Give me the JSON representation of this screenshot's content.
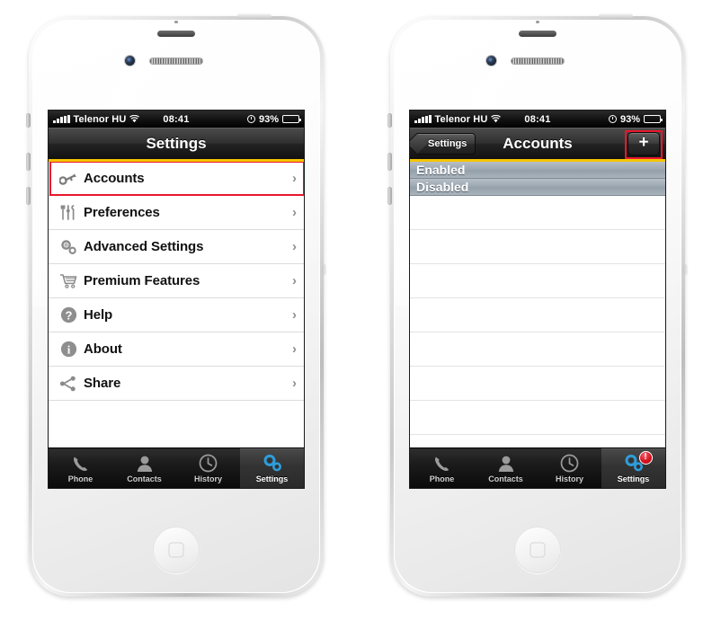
{
  "statusbar": {
    "carrier": "Telenor HU",
    "time": "08:41",
    "battery_percent": "93%",
    "signal_icon": "signal-bars-icon",
    "wifi_icon": "wifi-icon",
    "alarm_icon": "alarm-clock-icon",
    "battery_icon": "battery-icon"
  },
  "phone_left": {
    "navbar": {
      "title": "Settings"
    },
    "menu": [
      {
        "label": "Accounts",
        "icon": "key-icon",
        "chevron": "›",
        "highlighted": true
      },
      {
        "label": "Preferences",
        "icon": "tools-icon",
        "chevron": "›",
        "highlighted": false
      },
      {
        "label": "Advanced Settings",
        "icon": "gears-icon",
        "chevron": "›",
        "highlighted": false
      },
      {
        "label": "Premium Features",
        "icon": "cart-icon",
        "chevron": "›",
        "highlighted": false
      },
      {
        "label": "Help",
        "icon": "question-icon",
        "chevron": "›",
        "highlighted": false
      },
      {
        "label": "About",
        "icon": "info-icon",
        "chevron": "›",
        "highlighted": false
      },
      {
        "label": "Share",
        "icon": "share-icon",
        "chevron": "›",
        "highlighted": false
      }
    ],
    "tabs": [
      {
        "label": "Phone",
        "icon": "phone-handset-icon",
        "active": false,
        "badge": null
      },
      {
        "label": "Contacts",
        "icon": "person-icon",
        "active": false,
        "badge": null
      },
      {
        "label": "History",
        "icon": "clock-icon",
        "active": false,
        "badge": null
      },
      {
        "label": "Settings",
        "icon": "gears-icon",
        "active": true,
        "badge": null
      }
    ]
  },
  "phone_right": {
    "navbar": {
      "back_label": "Settings",
      "title": "Accounts",
      "add_label": "+",
      "add_highlighted": true
    },
    "groups": [
      {
        "label": "Enabled",
        "rows": []
      },
      {
        "label": "Disabled",
        "rows": []
      }
    ],
    "empty_rows": 8,
    "tabs": [
      {
        "label": "Phone",
        "icon": "phone-handset-icon",
        "active": false,
        "badge": null
      },
      {
        "label": "Contacts",
        "icon": "person-icon",
        "active": false,
        "badge": null
      },
      {
        "label": "History",
        "icon": "clock-icon",
        "active": false,
        "badge": null
      },
      {
        "label": "Settings",
        "icon": "gears-icon",
        "active": true,
        "badge": "!"
      }
    ]
  },
  "highlight_color": "#e8172b",
  "accent_color": "#f5c400",
  "tab_icon_active_color": "#2e9ddb"
}
